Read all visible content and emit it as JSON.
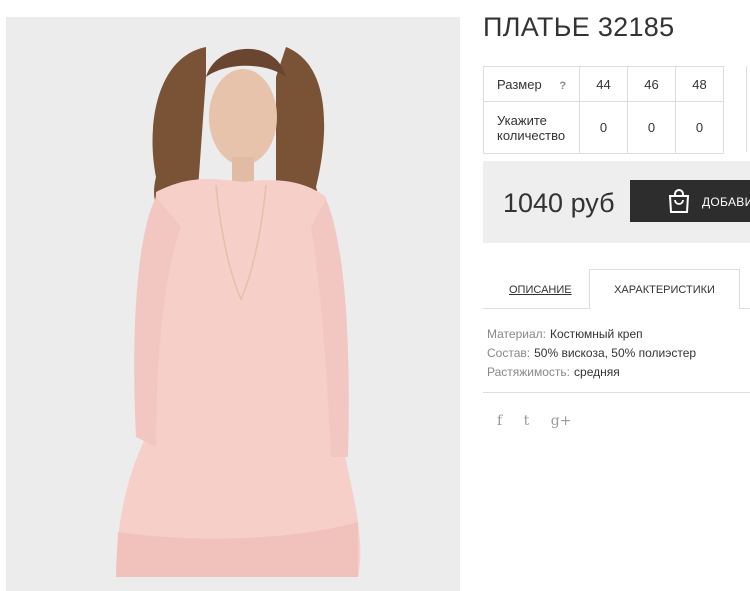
{
  "product": {
    "title": "ПЛАТЬЕ 32185",
    "price": "1040 руб",
    "add_to_cart_label": "ДОБАВИТЬ"
  },
  "size_table": {
    "size_label": "Размер",
    "help_icon": "?",
    "sizes": [
      "44",
      "46",
      "48"
    ],
    "quantity_label": "Укажите количество",
    "quantities": [
      "0",
      "0",
      "0"
    ]
  },
  "tabs": {
    "description": "ОПИСАНИЕ",
    "characteristics": "ХАРАКТЕРИСТИКИ",
    "active": "characteristics"
  },
  "characteristics": [
    {
      "key": "Материал:",
      "value": "Костюмный креп"
    },
    {
      "key": "Состав:",
      "value": "50% вискоза, 50% полиэстер"
    },
    {
      "key": "Растяжимость:",
      "value": "средняя"
    }
  ],
  "social": [
    {
      "icon": "facebook-icon",
      "glyph": "f"
    },
    {
      "icon": "twitter-icon",
      "glyph": "t"
    },
    {
      "icon": "google-plus-icon",
      "glyph": "g+"
    }
  ],
  "colors": {
    "photo_background": "#ececec",
    "dress": "#f6cfc9",
    "button": "#2d2d2d",
    "price_box": "#eeeeee"
  }
}
